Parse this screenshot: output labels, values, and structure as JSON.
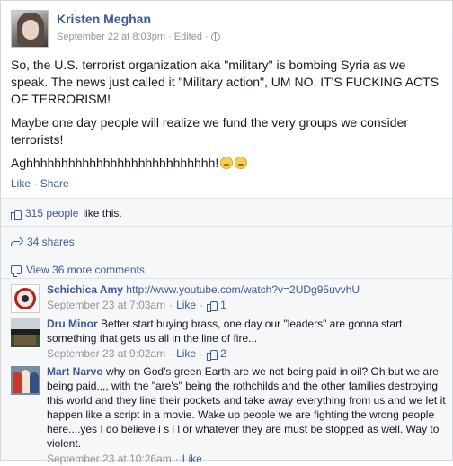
{
  "post": {
    "author": "Kristen Meghan",
    "date": "September 22 at 8:03pm",
    "edited": "Edited",
    "paragraphs": [
      "So, the U.S. terrorist organization aka \"military\" is bombing Syria as we speak. The news just called it \"Military action\", UM NO, IT'S FUCKING ACTS OF TERRORISM!",
      "Maybe one day people will realize we fund the very groups we consider terrorists!",
      "Aghhhhhhhhhhhhhhhhhhhhhhhhhhh!"
    ],
    "like_label": "Like",
    "share_label": "Share"
  },
  "ufi": {
    "likes_count": "315 people",
    "likes_suffix": "like this.",
    "shares": "34 shares",
    "view_more": "View 36 more comments"
  },
  "comments": [
    {
      "name": "Schichica Amy",
      "text": "http://www.youtube.com/watch?v=2UDg95uvvhU",
      "timestamp": "September 23 at 7:03am",
      "like_label": "Like",
      "like_count": "1"
    },
    {
      "name": "Dru Minor",
      "text": "Better start buying brass, one day our \"leaders\" are gonna start something that gets us all in the line of fire...",
      "timestamp": "September 23 at 9:02am",
      "like_label": "Like",
      "like_count": "2"
    },
    {
      "name": "Mart Narvo",
      "text": "why on God's green Earth are we not being paid in oil? Oh but we are being paid,,,, with the \"are's\" being the rothchilds and the other families destroying this world and they line their pockets and take away everything from us and we let it happen like a script in a movie. Wake up people we are fighting the wrong people here....yes I do believe i s i l or whatever they are must be stopped as well. Way to violent.",
      "timestamp": "September 23 at 10:26am",
      "like_label": "Like"
    }
  ],
  "colors": {
    "link": "#3b5998",
    "meta": "#90949c",
    "ufi_bg": "#f6f7f9"
  },
  "icons": [
    "globe-icon",
    "like-icon",
    "share-icon",
    "comment-icon",
    "emoji-icon"
  ]
}
